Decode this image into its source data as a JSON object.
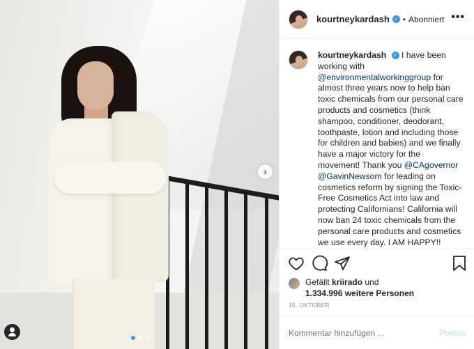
{
  "post": {
    "username": "kourtneykardash",
    "verified_icon": "verified-badge-icon",
    "separator": "•",
    "follow_status": "Abonniert",
    "more_label": "•••",
    "caption_prefix": "I have been working with ",
    "mention_1": "@environmentalworkinggroup",
    "caption_mid": " for almost three years now to help ban toxic chemicals from our personal care products and cosmetics (think shampoo, conditioner, deodorant, toothpaste, lotion and including those for children and babies) and we finally have a major victory for the movement! Thank you ",
    "mention_2": "@CAgovernor",
    "mention_3": "@GavinNewsom",
    "caption_end": " for leading on cosmetics reform by signing the Toxic-Free Cosmetics Act into law and protecting Californians! California will now ban 24 toxic chemicals from the personal care products and cosmetics we use every day. I AM HAPPY!!"
  },
  "likes": {
    "liked_by_prefix": "Gefällt ",
    "liked_by_user": "kriirado",
    "liked_by_suffix": " und",
    "others": "1.334.996 weitere Personen"
  },
  "date": "15. OKTOBER",
  "comment": {
    "placeholder": "Kommentar hinzufügen ...",
    "post_label": "Posten"
  },
  "photo": {
    "next_arrow": "›",
    "carousel_dots": 3,
    "active_dot": 1
  },
  "colors": {
    "accent_blue": "#3897f0",
    "mention": "#003569",
    "muted": "#8e8e8e",
    "post_disabled": "#b2dffc"
  }
}
